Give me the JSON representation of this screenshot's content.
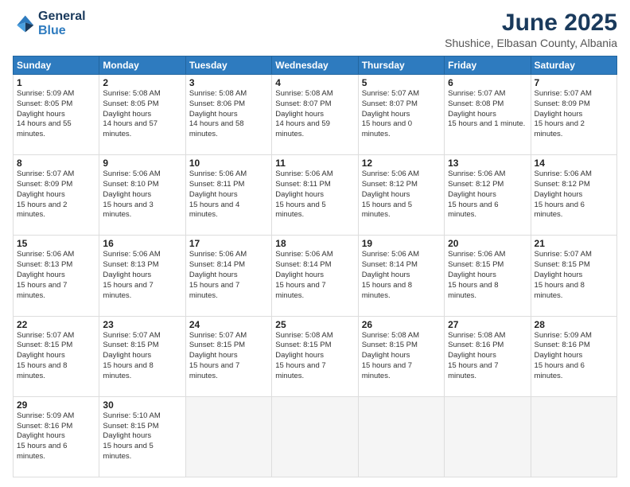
{
  "header": {
    "logo_line1": "General",
    "logo_line2": "Blue",
    "main_title": "June 2025",
    "subtitle": "Shushice, Elbasan County, Albania"
  },
  "weekdays": [
    "Sunday",
    "Monday",
    "Tuesday",
    "Wednesday",
    "Thursday",
    "Friday",
    "Saturday"
  ],
  "weeks": [
    [
      {
        "day": "1",
        "rise": "5:09 AM",
        "set": "8:05 PM",
        "dh": "14 hours and 55 minutes."
      },
      {
        "day": "2",
        "rise": "5:08 AM",
        "set": "8:05 PM",
        "dh": "14 hours and 57 minutes."
      },
      {
        "day": "3",
        "rise": "5:08 AM",
        "set": "8:06 PM",
        "dh": "14 hours and 58 minutes."
      },
      {
        "day": "4",
        "rise": "5:08 AM",
        "set": "8:07 PM",
        "dh": "14 hours and 59 minutes."
      },
      {
        "day": "5",
        "rise": "5:07 AM",
        "set": "8:07 PM",
        "dh": "15 hours and 0 minutes."
      },
      {
        "day": "6",
        "rise": "5:07 AM",
        "set": "8:08 PM",
        "dh": "15 hours and 1 minute."
      },
      {
        "day": "7",
        "rise": "5:07 AM",
        "set": "8:09 PM",
        "dh": "15 hours and 2 minutes."
      }
    ],
    [
      {
        "day": "8",
        "rise": "5:07 AM",
        "set": "8:09 PM",
        "dh": "15 hours and 2 minutes."
      },
      {
        "day": "9",
        "rise": "5:06 AM",
        "set": "8:10 PM",
        "dh": "15 hours and 3 minutes."
      },
      {
        "day": "10",
        "rise": "5:06 AM",
        "set": "8:11 PM",
        "dh": "15 hours and 4 minutes."
      },
      {
        "day": "11",
        "rise": "5:06 AM",
        "set": "8:11 PM",
        "dh": "15 hours and 5 minutes."
      },
      {
        "day": "12",
        "rise": "5:06 AM",
        "set": "8:12 PM",
        "dh": "15 hours and 5 minutes."
      },
      {
        "day": "13",
        "rise": "5:06 AM",
        "set": "8:12 PM",
        "dh": "15 hours and 6 minutes."
      },
      {
        "day": "14",
        "rise": "5:06 AM",
        "set": "8:12 PM",
        "dh": "15 hours and 6 minutes."
      }
    ],
    [
      {
        "day": "15",
        "rise": "5:06 AM",
        "set": "8:13 PM",
        "dh": "15 hours and 7 minutes."
      },
      {
        "day": "16",
        "rise": "5:06 AM",
        "set": "8:13 PM",
        "dh": "15 hours and 7 minutes."
      },
      {
        "day": "17",
        "rise": "5:06 AM",
        "set": "8:14 PM",
        "dh": "15 hours and 7 minutes."
      },
      {
        "day": "18",
        "rise": "5:06 AM",
        "set": "8:14 PM",
        "dh": "15 hours and 7 minutes."
      },
      {
        "day": "19",
        "rise": "5:06 AM",
        "set": "8:14 PM",
        "dh": "15 hours and 8 minutes."
      },
      {
        "day": "20",
        "rise": "5:06 AM",
        "set": "8:15 PM",
        "dh": "15 hours and 8 minutes."
      },
      {
        "day": "21",
        "rise": "5:07 AM",
        "set": "8:15 PM",
        "dh": "15 hours and 8 minutes."
      }
    ],
    [
      {
        "day": "22",
        "rise": "5:07 AM",
        "set": "8:15 PM",
        "dh": "15 hours and 8 minutes."
      },
      {
        "day": "23",
        "rise": "5:07 AM",
        "set": "8:15 PM",
        "dh": "15 hours and 8 minutes."
      },
      {
        "day": "24",
        "rise": "5:07 AM",
        "set": "8:15 PM",
        "dh": "15 hours and 7 minutes."
      },
      {
        "day": "25",
        "rise": "5:08 AM",
        "set": "8:15 PM",
        "dh": "15 hours and 7 minutes."
      },
      {
        "day": "26",
        "rise": "5:08 AM",
        "set": "8:15 PM",
        "dh": "15 hours and 7 minutes."
      },
      {
        "day": "27",
        "rise": "5:08 AM",
        "set": "8:16 PM",
        "dh": "15 hours and 7 minutes."
      },
      {
        "day": "28",
        "rise": "5:09 AM",
        "set": "8:16 PM",
        "dh": "15 hours and 6 minutes."
      }
    ],
    [
      {
        "day": "29",
        "rise": "5:09 AM",
        "set": "8:16 PM",
        "dh": "15 hours and 6 minutes."
      },
      {
        "day": "30",
        "rise": "5:10 AM",
        "set": "8:15 PM",
        "dh": "15 hours and 5 minutes."
      },
      null,
      null,
      null,
      null,
      null
    ]
  ]
}
